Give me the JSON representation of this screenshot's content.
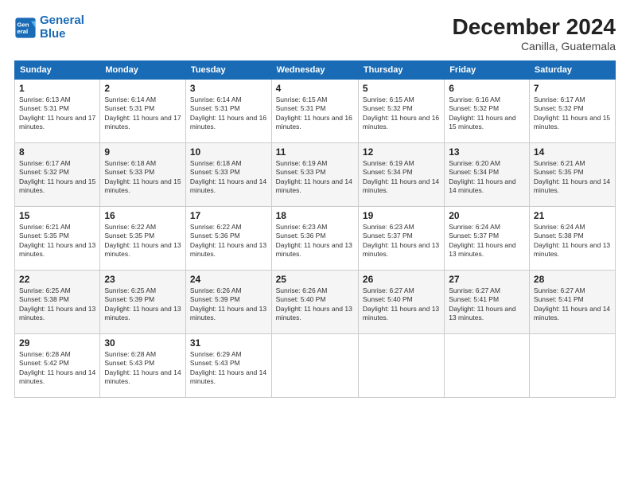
{
  "header": {
    "logo_line1": "General",
    "logo_line2": "Blue",
    "month": "December 2024",
    "location": "Canilla, Guatemala"
  },
  "days_of_week": [
    "Sunday",
    "Monday",
    "Tuesday",
    "Wednesday",
    "Thursday",
    "Friday",
    "Saturday"
  ],
  "weeks": [
    [
      {
        "day": "1",
        "info": "Sunrise: 6:13 AM\nSunset: 5:31 PM\nDaylight: 11 hours and 17 minutes."
      },
      {
        "day": "2",
        "info": "Sunrise: 6:14 AM\nSunset: 5:31 PM\nDaylight: 11 hours and 17 minutes."
      },
      {
        "day": "3",
        "info": "Sunrise: 6:14 AM\nSunset: 5:31 PM\nDaylight: 11 hours and 16 minutes."
      },
      {
        "day": "4",
        "info": "Sunrise: 6:15 AM\nSunset: 5:31 PM\nDaylight: 11 hours and 16 minutes."
      },
      {
        "day": "5",
        "info": "Sunrise: 6:15 AM\nSunset: 5:32 PM\nDaylight: 11 hours and 16 minutes."
      },
      {
        "day": "6",
        "info": "Sunrise: 6:16 AM\nSunset: 5:32 PM\nDaylight: 11 hours and 15 minutes."
      },
      {
        "day": "7",
        "info": "Sunrise: 6:17 AM\nSunset: 5:32 PM\nDaylight: 11 hours and 15 minutes."
      }
    ],
    [
      {
        "day": "8",
        "info": "Sunrise: 6:17 AM\nSunset: 5:32 PM\nDaylight: 11 hours and 15 minutes."
      },
      {
        "day": "9",
        "info": "Sunrise: 6:18 AM\nSunset: 5:33 PM\nDaylight: 11 hours and 15 minutes."
      },
      {
        "day": "10",
        "info": "Sunrise: 6:18 AM\nSunset: 5:33 PM\nDaylight: 11 hours and 14 minutes."
      },
      {
        "day": "11",
        "info": "Sunrise: 6:19 AM\nSunset: 5:33 PM\nDaylight: 11 hours and 14 minutes."
      },
      {
        "day": "12",
        "info": "Sunrise: 6:19 AM\nSunset: 5:34 PM\nDaylight: 11 hours and 14 minutes."
      },
      {
        "day": "13",
        "info": "Sunrise: 6:20 AM\nSunset: 5:34 PM\nDaylight: 11 hours and 14 minutes."
      },
      {
        "day": "14",
        "info": "Sunrise: 6:21 AM\nSunset: 5:35 PM\nDaylight: 11 hours and 14 minutes."
      }
    ],
    [
      {
        "day": "15",
        "info": "Sunrise: 6:21 AM\nSunset: 5:35 PM\nDaylight: 11 hours and 13 minutes."
      },
      {
        "day": "16",
        "info": "Sunrise: 6:22 AM\nSunset: 5:35 PM\nDaylight: 11 hours and 13 minutes."
      },
      {
        "day": "17",
        "info": "Sunrise: 6:22 AM\nSunset: 5:36 PM\nDaylight: 11 hours and 13 minutes."
      },
      {
        "day": "18",
        "info": "Sunrise: 6:23 AM\nSunset: 5:36 PM\nDaylight: 11 hours and 13 minutes."
      },
      {
        "day": "19",
        "info": "Sunrise: 6:23 AM\nSunset: 5:37 PM\nDaylight: 11 hours and 13 minutes."
      },
      {
        "day": "20",
        "info": "Sunrise: 6:24 AM\nSunset: 5:37 PM\nDaylight: 11 hours and 13 minutes."
      },
      {
        "day": "21",
        "info": "Sunrise: 6:24 AM\nSunset: 5:38 PM\nDaylight: 11 hours and 13 minutes."
      }
    ],
    [
      {
        "day": "22",
        "info": "Sunrise: 6:25 AM\nSunset: 5:38 PM\nDaylight: 11 hours and 13 minutes."
      },
      {
        "day": "23",
        "info": "Sunrise: 6:25 AM\nSunset: 5:39 PM\nDaylight: 11 hours and 13 minutes."
      },
      {
        "day": "24",
        "info": "Sunrise: 6:26 AM\nSunset: 5:39 PM\nDaylight: 11 hours and 13 minutes."
      },
      {
        "day": "25",
        "info": "Sunrise: 6:26 AM\nSunset: 5:40 PM\nDaylight: 11 hours and 13 minutes."
      },
      {
        "day": "26",
        "info": "Sunrise: 6:27 AM\nSunset: 5:40 PM\nDaylight: 11 hours and 13 minutes."
      },
      {
        "day": "27",
        "info": "Sunrise: 6:27 AM\nSunset: 5:41 PM\nDaylight: 11 hours and 13 minutes."
      },
      {
        "day": "28",
        "info": "Sunrise: 6:27 AM\nSunset: 5:41 PM\nDaylight: 11 hours and 14 minutes."
      }
    ],
    [
      {
        "day": "29",
        "info": "Sunrise: 6:28 AM\nSunset: 5:42 PM\nDaylight: 11 hours and 14 minutes."
      },
      {
        "day": "30",
        "info": "Sunrise: 6:28 AM\nSunset: 5:43 PM\nDaylight: 11 hours and 14 minutes."
      },
      {
        "day": "31",
        "info": "Sunrise: 6:29 AM\nSunset: 5:43 PM\nDaylight: 11 hours and 14 minutes."
      },
      {
        "day": "",
        "info": ""
      },
      {
        "day": "",
        "info": ""
      },
      {
        "day": "",
        "info": ""
      },
      {
        "day": "",
        "info": ""
      }
    ]
  ]
}
